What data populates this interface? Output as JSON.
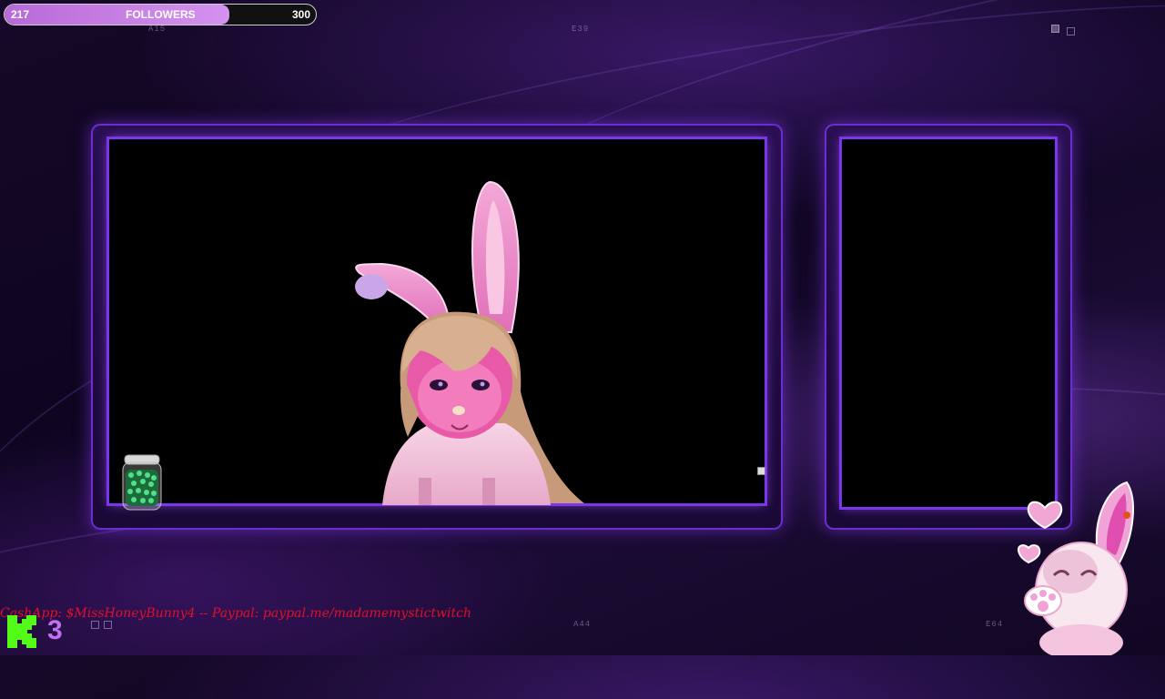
{
  "followers": {
    "current": "217",
    "label": "FOLLOWERS",
    "goal": "300",
    "progress_fraction": 0.723
  },
  "corner_codes": {
    "top_left": "A15",
    "top_center": "E39",
    "bottom_center": "A44",
    "bottom_right": "E64"
  },
  "ticker": {
    "text": "CashApp: $MissHoneyBunny4  --   Paypal: paypal.me/madamemystictwitch"
  },
  "kick": {
    "count": "3"
  },
  "colors": {
    "accent": "#7a36ee",
    "bar_fill": "#d592ef",
    "ticker": "#e0102a"
  },
  "icons": {
    "kick": "kick-logo-icon",
    "jar": "bean-jar-icon",
    "mascot": "bunny-mascot-icon"
  }
}
